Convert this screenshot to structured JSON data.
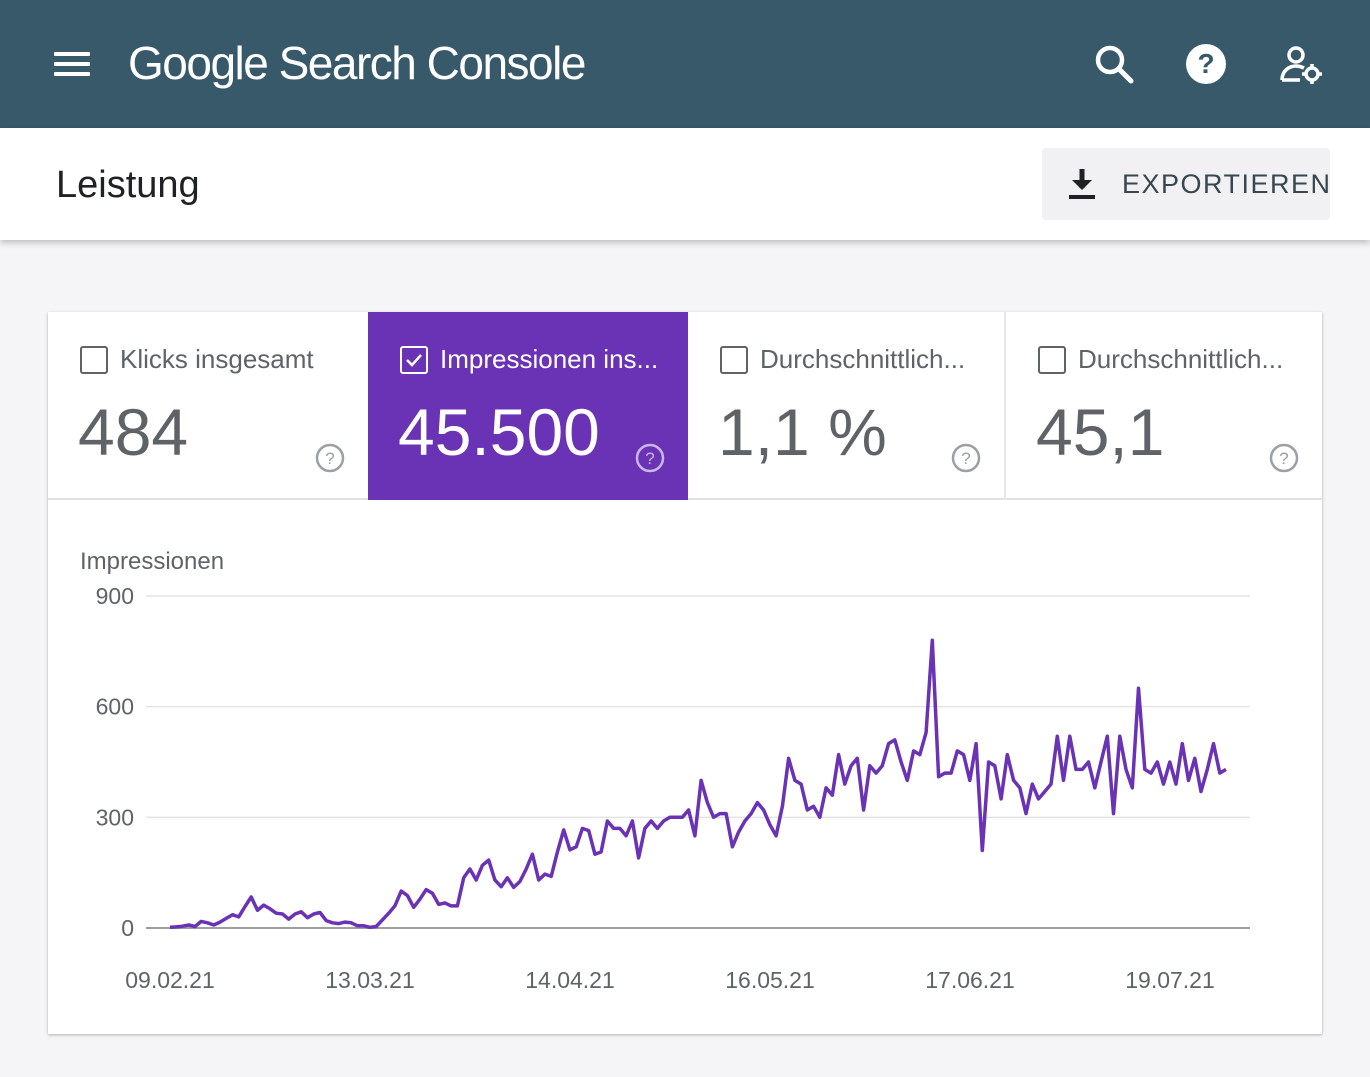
{
  "header": {
    "logo_google": "Google",
    "logo_product": "Search Console",
    "icons": [
      "menu-icon",
      "search-icon",
      "help-icon",
      "account-settings-icon"
    ],
    "bg_color": "#37596a"
  },
  "subheader": {
    "title": "Leistung",
    "export_label": "EXPORTIEREN",
    "export_icon": "download-icon"
  },
  "metrics": [
    {
      "label": "Klicks insgesamt",
      "value": "484",
      "checked": false
    },
    {
      "label": "Impressionen ins...",
      "value": "45.500",
      "checked": true,
      "color": "#6a32b5"
    },
    {
      "label": "Durchschnittlich...",
      "value": "1,1 %",
      "checked": false
    },
    {
      "label": "Durchschnittlich...",
      "value": "45,1",
      "checked": false
    }
  ],
  "chart_data": {
    "type": "line",
    "ylabel": "Impressionen",
    "ylim": [
      0,
      900
    ],
    "yticks": [
      "0",
      "300",
      "600",
      "900"
    ],
    "x_tick_labels": [
      "09.02.21",
      "13.03.21",
      "14.04.21",
      "16.05.21",
      "17.06.21",
      "19.07.21"
    ],
    "x_start": "09.02.21",
    "series": [
      {
        "color": "#6a32b5",
        "values": [
          2,
          3,
          5,
          8,
          4,
          18,
          14,
          8,
          16,
          26,
          36,
          30,
          58,
          84,
          48,
          62,
          52,
          40,
          38,
          24,
          38,
          44,
          28,
          38,
          42,
          20,
          14,
          12,
          16,
          14,
          6,
          6,
          2,
          4,
          22,
          40,
          60,
          100,
          88,
          56,
          78,
          104,
          94,
          64,
          68,
          60,
          60,
          136,
          160,
          130,
          170,
          184,
          130,
          112,
          136,
          110,
          126,
          160,
          200,
          130,
          146,
          140,
          206,
          266,
          212,
          220,
          270,
          264,
          200,
          206,
          290,
          270,
          270,
          250,
          290,
          190,
          270,
          290,
          270,
          290,
          300,
          300,
          300,
          320,
          250,
          400,
          340,
          300,
          310,
          310,
          220,
          260,
          290,
          310,
          340,
          320,
          280,
          250,
          330,
          460,
          400,
          390,
          320,
          330,
          300,
          380,
          360,
          470,
          390,
          440,
          460,
          320,
          440,
          420,
          440,
          500,
          510,
          450,
          400,
          480,
          470,
          530,
          780,
          410,
          420,
          420,
          480,
          470,
          400,
          500,
          210,
          450,
          440,
          350,
          470,
          400,
          380,
          310,
          390,
          350,
          370,
          390,
          520,
          400,
          520,
          430,
          430,
          450,
          380,
          450,
          520,
          310,
          520,
          430,
          380,
          650,
          430,
          420,
          450,
          390,
          450,
          390,
          500,
          400,
          460,
          370,
          430,
          500,
          420,
          430
        ]
      }
    ]
  }
}
